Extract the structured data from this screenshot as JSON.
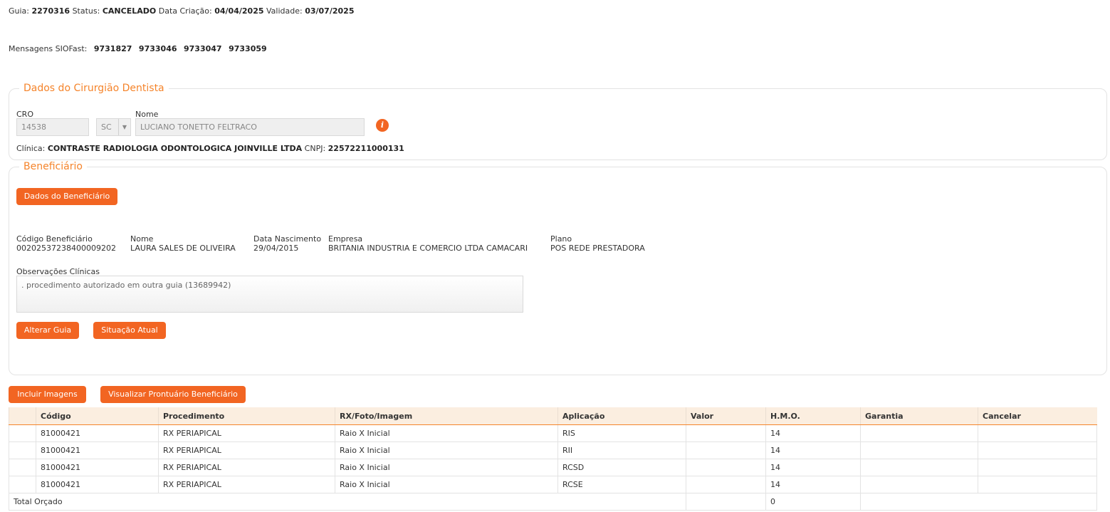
{
  "header": {
    "guia_label": "Guia:",
    "guia_value": "2270316",
    "status_label": "Status:",
    "status_value": "CANCELADO",
    "criacao_label": "Data Criação:",
    "criacao_value": "04/04/2025",
    "validade_label": "Validade:",
    "validade_value": "03/07/2025"
  },
  "mensagens": {
    "label": "Mensagens SIOFast:",
    "items": [
      "9731827",
      "9733046",
      "9733047",
      "9733059"
    ]
  },
  "dentista": {
    "legend": "Dados do Cirurgião Dentista",
    "cro_label": "CRO",
    "cro_value": "14538",
    "uf_value": "SC",
    "nome_label": "Nome",
    "nome_value": "LUCIANO TONETTO FELTRACO",
    "clinica_label": "Clínica:",
    "clinica_value": "CONTRASTE RADIOLOGIA ODONTOLOGICA JOINVILLE LTDA",
    "cnpj_label": "CNPJ:",
    "cnpj_value": "22572211000131"
  },
  "beneficiario": {
    "legend": "Beneficiário",
    "dados_button": "Dados do Beneficiário",
    "codigo_label": "Código Beneficiário",
    "codigo_value": "00202537238400009202",
    "nome_label": "Nome",
    "nome_value": "LAURA SALES DE OLIVEIRA",
    "nascimento_label": "Data Nascimento",
    "nascimento_value": "29/04/2015",
    "empresa_label": "Empresa",
    "empresa_value": "BRITANIA INDUSTRIA E COMERCIO LTDA CAMACARI",
    "plano_label": "Plano",
    "plano_value": "POS REDE PRESTADORA",
    "obs_label": "Observações Clínicas",
    "obs_value": ". procedimento autorizado em outra guia (13689942)",
    "alterar_button": "Alterar Guia",
    "situacao_button": "Situação Atual"
  },
  "actions": {
    "incluir_button": "Incluir Imagens",
    "prontuario_button": "Visualizar Prontuário Beneficiário"
  },
  "table": {
    "headers": [
      "",
      "Código",
      "Procedimento",
      "RX/Foto/Imagem",
      "Aplicação",
      "Valor",
      "H.M.O.",
      "Garantia",
      "Cancelar"
    ],
    "rows": [
      [
        "",
        "81000421",
        "RX PERIAPICAL",
        "Raio X Inicial",
        "RIS",
        "",
        "14",
        "",
        ""
      ],
      [
        "",
        "81000421",
        "RX PERIAPICAL",
        "Raio X Inicial",
        "RII",
        "",
        "14",
        "",
        ""
      ],
      [
        "",
        "81000421",
        "RX PERIAPICAL",
        "Raio X Inicial",
        "RCSD",
        "",
        "14",
        "",
        ""
      ],
      [
        "",
        "81000421",
        "RX PERIAPICAL",
        "Raio X Inicial",
        "RCSE",
        "",
        "14",
        "",
        ""
      ]
    ],
    "total_label": "Total Orçado",
    "total_hmo": "0"
  },
  "colors": {
    "accent": "#f26522",
    "legend": "#f5842b",
    "header_bg": "#fbeee0"
  }
}
